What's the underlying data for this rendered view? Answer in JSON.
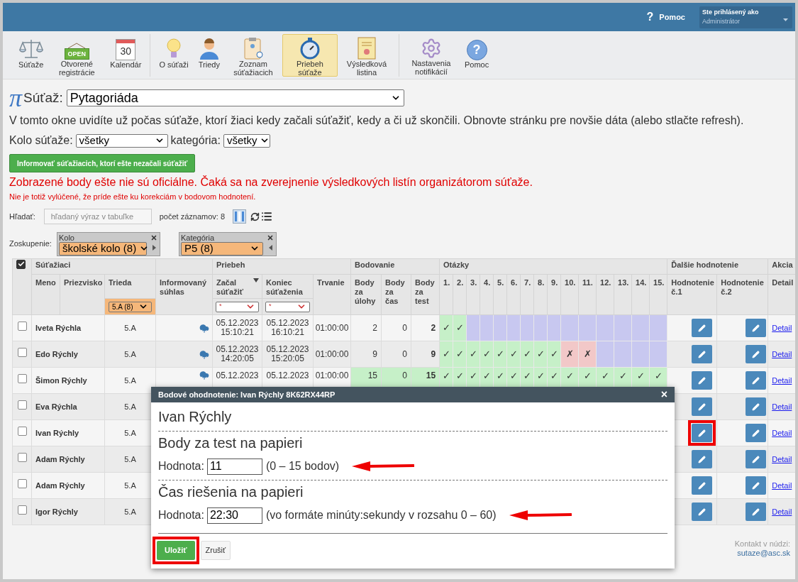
{
  "top_bar": {
    "help_mark": "?",
    "help_label": "Pomoc",
    "user_caption": "Ste prihlásený ako",
    "user_role": "Administrátor"
  },
  "toolbar_groups": [
    {
      "items": [
        {
          "label": "Súťaže",
          "selected": false
        },
        {
          "label": "Otvorené registrácie",
          "icon_text": "OPEN",
          "selected": false
        },
        {
          "label": "Kalendár",
          "icon_text": "30",
          "selected": false
        }
      ]
    },
    {
      "items": [
        {
          "label": "O súťaži",
          "selected": false
        },
        {
          "label": "Triedy",
          "selected": false
        },
        {
          "label": "Zoznam súťažiacich",
          "selected": false
        },
        {
          "label": "Priebeh súťaže",
          "selected": true
        },
        {
          "label": "Výsledková listina",
          "selected": false
        }
      ]
    },
    {
      "items": [
        {
          "label": "Nastavenia notifikácií",
          "selected": false
        },
        {
          "label": "Pomoc",
          "icon_text": "?",
          "selected": false
        }
      ]
    }
  ],
  "contest": {
    "logo": "π",
    "label": "Súťaž:",
    "value": "Pytagoriáda"
  },
  "description": "V tomto okne uvidíte už počas súťaže, ktorí žiaci kedy začali súťažiť, kedy a či už skončili. Obnovte stránku pre novšie dáta (alebo stlačte refresh).",
  "filters": [
    {
      "label": "Kolo súťaže:",
      "value": "všetky"
    },
    {
      "label": "kategória:",
      "value": "všetky"
    }
  ],
  "notify_button": "Informovať súťažiacich, ktorí ešte nezačali súťažiť",
  "warning": "Zobrazené body ešte nie sú oficiálne. Čaká sa na zverejnenie výsledkových listín organizátorom súťaže.",
  "warning_note": "Nie je totiž vylúčené, že príde ešte ku korekciám v bodovom hodnotení.",
  "search": {
    "label": "Hľadať:",
    "placeholder": "hľadaný výraz v tabuľke",
    "count": "počet záznamov: 8"
  },
  "grouping": {
    "label": "Zoskupenie:",
    "groups": [
      {
        "title": "Kolo",
        "value": "školské kolo (8)",
        "points_left": false
      },
      {
        "title": "Kategória",
        "value": "P5 (8)",
        "points_left": true
      }
    ]
  },
  "table": {
    "select_all_checked": true,
    "groups": [
      "Súťažiaci",
      "Priebeh",
      "Bodovanie",
      "Otázky",
      "Ďalšie hodnotenie",
      "Akcia"
    ],
    "columns": {
      "first_name": "Meno",
      "last_name": "Priezvisko",
      "class": "Trieda",
      "consent": "Informovaný súhlas",
      "start": "Začal súťažiť",
      "end": "Koniec súťaženia",
      "duration": "Trvanie",
      "points_tasks": "Body za úlohy",
      "points_time": "Body za čas",
      "points_test": "Body za test",
      "eval1": "Hodnotenie č.1",
      "eval2": "Hodnotenie č.2",
      "detail": "Detail"
    },
    "questions": [
      "1.",
      "2.",
      "3.",
      "4.",
      "5.",
      "6.",
      "7.",
      "8.",
      "9.",
      "10.",
      "11.",
      "12.",
      "13.",
      "14.",
      "15."
    ],
    "class_filter": "5.A (8)",
    "start_filter": "*",
    "end_filter": "*",
    "rows": [
      {
        "checked": false,
        "name": "Iveta Rýchla",
        "class": "5.A",
        "consent": true,
        "start": [
          "05.12.2023",
          "15:10:21"
        ],
        "end": [
          "05.12.2023",
          "16:10:21"
        ],
        "duration": "01:00:00",
        "points_tasks": "2",
        "points_time": "0",
        "points_test": "2",
        "full_score": false,
        "answers": [
          {
            "answered": true,
            "correct": true,
            "mark": "✓"
          },
          {
            "answered": true,
            "correct": true,
            "mark": "✓"
          },
          {
            "answered": false
          },
          {
            "answered": false
          },
          {
            "answered": false
          },
          {
            "answered": false
          },
          {
            "answered": false
          },
          {
            "answered": false
          },
          {
            "answered": false
          },
          {
            "answered": false
          },
          {
            "answered": false
          },
          {
            "answered": false
          },
          {
            "answered": false
          },
          {
            "answered": false
          },
          {
            "answered": false
          }
        ],
        "marked": false,
        "detail": "Detail"
      },
      {
        "checked": false,
        "name": "Edo Rýchly",
        "class": "5.A",
        "consent": true,
        "start": [
          "05.12.2023",
          "14:20:05"
        ],
        "end": [
          "05.12.2023",
          "15:20:05"
        ],
        "duration": "01:00:00",
        "points_tasks": "9",
        "points_time": "0",
        "points_test": "9",
        "full_score": false,
        "answers": [
          {
            "answered": true,
            "correct": true,
            "mark": "✓"
          },
          {
            "answered": true,
            "correct": true,
            "mark": "✓"
          },
          {
            "answered": true,
            "correct": true,
            "mark": "✓"
          },
          {
            "answered": true,
            "correct": true,
            "mark": "✓"
          },
          {
            "answered": true,
            "correct": true,
            "mark": "✓"
          },
          {
            "answered": true,
            "correct": true,
            "mark": "✓"
          },
          {
            "answered": true,
            "correct": true,
            "mark": "✓"
          },
          {
            "answered": true,
            "correct": true,
            "mark": "✓"
          },
          {
            "answered": true,
            "correct": true,
            "mark": "✓"
          },
          {
            "answered": true,
            "correct": false,
            "mark": "✗"
          },
          {
            "answered": true,
            "correct": false,
            "mark": "✗"
          },
          {
            "answered": false
          },
          {
            "answered": false
          },
          {
            "answered": false
          },
          {
            "answered": false
          }
        ],
        "marked": false,
        "detail": "Detail"
      },
      {
        "checked": false,
        "name": "Šimon Rýchly",
        "class": "5.A",
        "consent": true,
        "start": [
          "05.12.2023"
        ],
        "end": [
          "05.12.2023"
        ],
        "duration": "01:00:00",
        "points_tasks": "15",
        "points_time": "0",
        "points_test": "15",
        "full_score": true,
        "answers": [
          {
            "answered": true,
            "correct": true,
            "mark": "✓"
          },
          {
            "answered": true,
            "correct": true,
            "mark": "✓"
          },
          {
            "answered": true,
            "correct": true,
            "mark": "✓"
          },
          {
            "answered": true,
            "correct": true,
            "mark": "✓"
          },
          {
            "answered": true,
            "correct": true,
            "mark": "✓"
          },
          {
            "answered": true,
            "correct": true,
            "mark": "✓"
          },
          {
            "answered": true,
            "correct": true,
            "mark": "✓"
          },
          {
            "answered": true,
            "correct": true,
            "mark": "✓"
          },
          {
            "answered": true,
            "correct": true,
            "mark": "✓"
          },
          {
            "answered": true,
            "correct": true,
            "mark": "✓"
          },
          {
            "answered": true,
            "correct": true,
            "mark": "✓"
          },
          {
            "answered": true,
            "correct": true,
            "mark": "✓"
          },
          {
            "answered": true,
            "correct": true,
            "mark": "✓"
          },
          {
            "answered": true,
            "correct": true,
            "mark": "✓"
          },
          {
            "answered": true,
            "correct": true,
            "mark": "✓"
          }
        ],
        "marked": false,
        "detail": "Detail"
      },
      {
        "checked": false,
        "name": "Eva Rýchla",
        "class": "5.A",
        "marked": false,
        "detail": "Detail"
      },
      {
        "checked": false,
        "name": "Ivan Rýchly",
        "class": "5.A",
        "marked": true,
        "detail": "Detail"
      },
      {
        "checked": false,
        "name": "Adam Rýchly",
        "class": "5.A",
        "marked": false,
        "detail": "Detail"
      },
      {
        "checked": false,
        "name": "Adam Rýchly",
        "class": "5.A",
        "marked": false,
        "detail": "Detail"
      },
      {
        "checked": false,
        "name": "Igor Rýchly",
        "class": "5.A",
        "marked": false,
        "detail": "Detail"
      }
    ]
  },
  "footer": {
    "label": "Kontakt v núdzi:",
    "email": "sutaze@asc.sk"
  },
  "dialog": {
    "title": "Bodové ohodnotenie: Ivan Rýchly 8K62RX44RP",
    "close": "×",
    "student": "Ivan Rýchly",
    "sections": [
      {
        "heading": "Body za test na papieri",
        "label": "Hodnota:",
        "value": "11",
        "hint": "(0 – 15 bodov)",
        "arrow": true
      },
      {
        "heading": "Čas riešenia na papieri",
        "label": "Hodnota:",
        "value": "22:30",
        "hint": "(vo formáte minúty:sekundy v rozsahu 0 – 60)",
        "arrow": true
      }
    ],
    "save": {
      "label": "Uložiť",
      "marked": true
    },
    "cancel": "Zrušiť"
  }
}
